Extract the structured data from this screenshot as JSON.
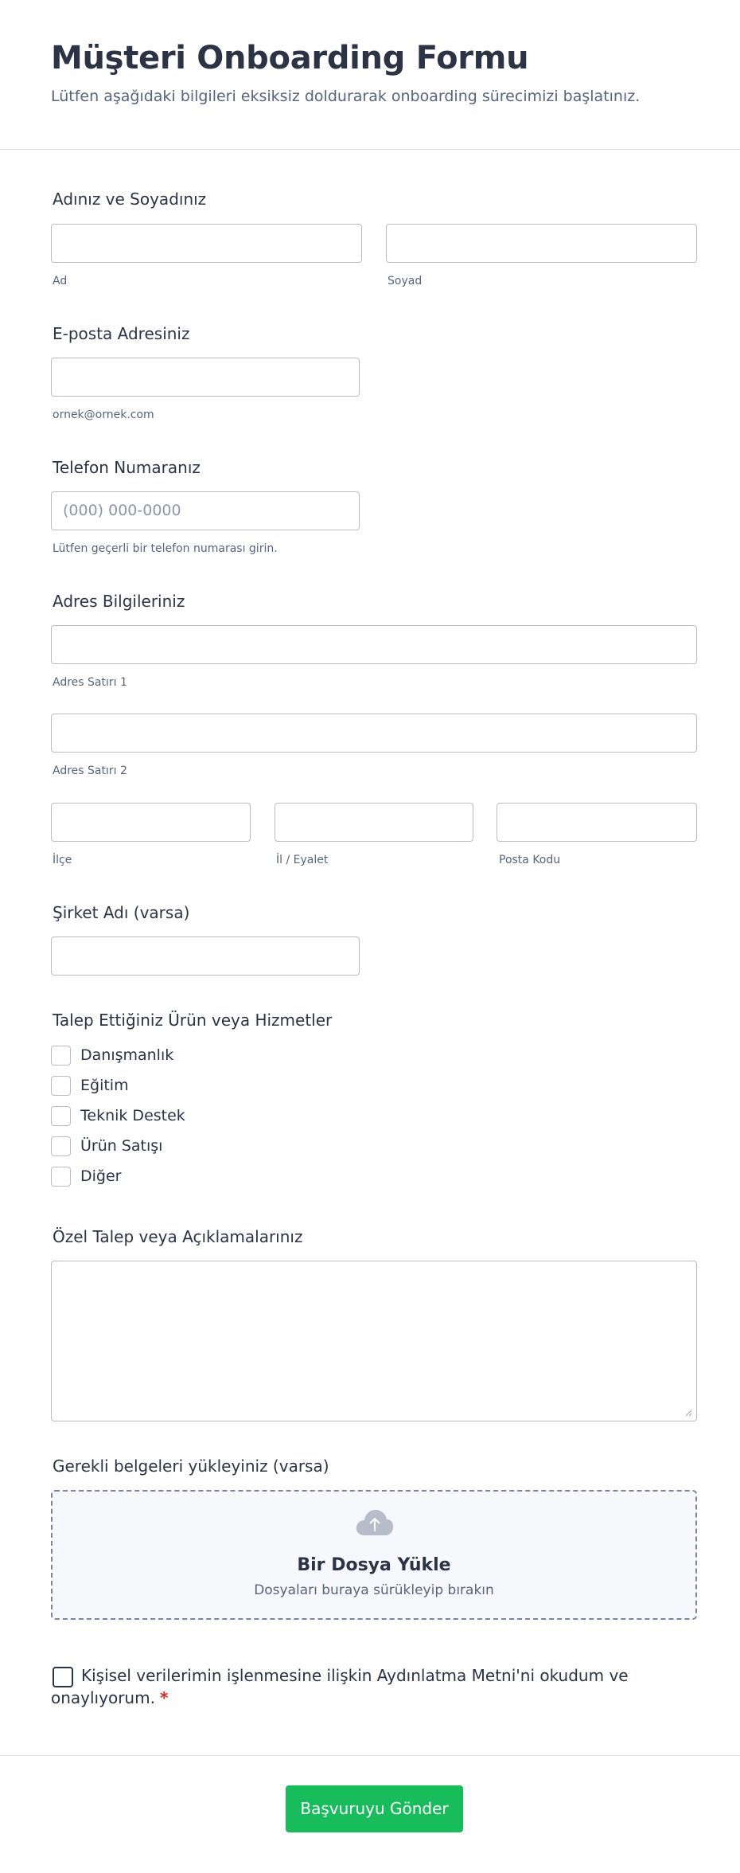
{
  "header": {
    "title": "Müşteri Onboarding Formu",
    "subtitle": "Lütfen aşağıdaki bilgileri eksiksiz doldurarak onboarding sürecimizi başlatınız."
  },
  "name_field": {
    "label": "Adınız ve Soyadınız",
    "first_sublabel": "Ad",
    "last_sublabel": "Soyad",
    "first_value": "",
    "last_value": ""
  },
  "email_field": {
    "label": "E-posta Adresiniz",
    "value": "",
    "sublabel": "ornek@ornek.com"
  },
  "phone_field": {
    "label": "Telefon Numaranız",
    "placeholder": "(000) 000-0000",
    "sublabel": "Lütfen geçerli bir telefon numarası girin."
  },
  "address_field": {
    "label": "Adres Bilgileriniz",
    "line1_sublabel": "Adres Satırı 1",
    "line2_sublabel": "Adres Satırı 2",
    "district_sublabel": "İlçe",
    "city_sublabel": "İl / Eyalet",
    "postal_sublabel": "Posta Kodu"
  },
  "company_field": {
    "label": "Şirket Adı (varsa)",
    "value": ""
  },
  "services_field": {
    "label": "Talep Ettiğiniz Ürün veya Hizmetler",
    "options": [
      {
        "label": "Danışmanlık",
        "checked": false
      },
      {
        "label": "Eğitim",
        "checked": false
      },
      {
        "label": "Teknik Destek",
        "checked": false
      },
      {
        "label": "Ürün Satışı",
        "checked": false
      },
      {
        "label": "Diğer",
        "checked": false
      }
    ]
  },
  "notes_field": {
    "label": "Özel Talep veya Açıklamalarınız",
    "value": ""
  },
  "upload_field": {
    "label": "Gerekli belgeleri yükleyiniz (varsa)",
    "title": "Bir Dosya Yükle",
    "subtitle": "Dosyaları buraya sürükleyip bırakın",
    "icon": "cloud-upload-icon"
  },
  "consent": {
    "line1": "Kişisel verilerimin işlenmesine ilişkin Aydınlatma Metni'ni okudum ve",
    "line2": "onaylıyorum.",
    "required_mark": "*",
    "checked": false
  },
  "submit": {
    "label": "Başvuruyu Gönder"
  },
  "colors": {
    "primary_text": "#2c3345",
    "secondary_text": "#57647e",
    "input_border": "#b8bdc9",
    "submit_bg": "#18bd5b",
    "required": "#e0261d"
  }
}
